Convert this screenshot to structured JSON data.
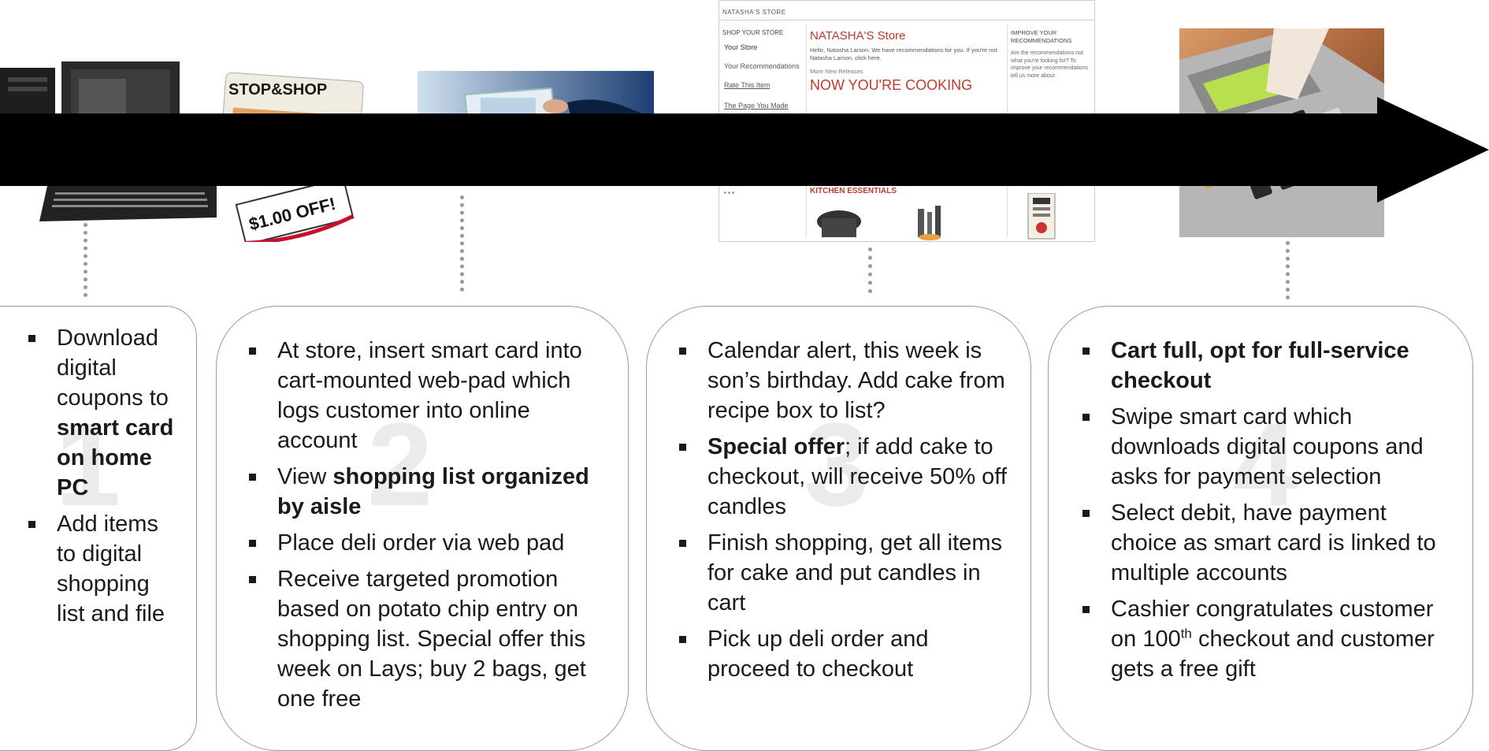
{
  "images": {
    "card_brand": "STOP&SHOP",
    "card_offer": "$1.00 OFF!",
    "store_header": "NATASHA'S STORE",
    "store_nav_title": "SHOP YOUR STORE",
    "store_nav_items": [
      "Your Store",
      "Your Recommendations",
      "Rate This Item",
      "The Page You Made"
    ],
    "store_title": "NATASHA'S Store",
    "store_greeting": "Hello, Natasha Larson. We have recommendations for you. If you're not Natasha Larson, click here.",
    "store_new_releases": "More New Releases",
    "store_banner": "NOW YOU'RE COOKING",
    "store_right_title": "IMPROVE YOUR RECOMMENDATIONS",
    "store_right_text": "Are the recommendations not what you're looking for? To improve your recommendations tell us more about",
    "store_kitchen": "KITCHEN ESSENTIALS"
  },
  "steps": [
    {
      "number": "1",
      "items": [
        {
          "pre": "Download digital coupons to ",
          "bold": "smart card on home PC",
          "post": ""
        },
        {
          "pre": "Add items to digital shopping list and file",
          "bold": "",
          "post": ""
        }
      ]
    },
    {
      "number": "2",
      "items": [
        {
          "pre": "At store, insert smart card into cart-mounted web-pad which logs customer into online account",
          "bold": "",
          "post": ""
        },
        {
          "pre": "View ",
          "bold": "shopping list organized by aisle",
          "post": ""
        },
        {
          "pre": "Place deli order via web pad",
          "bold": "",
          "post": ""
        },
        {
          "pre": "Receive targeted promotion based on potato chip entry on shopping list. Special offer this week on Lays; buy 2 bags, get one free",
          "bold": "",
          "post": ""
        }
      ]
    },
    {
      "number": "3",
      "items": [
        {
          "pre": "Calendar alert, this week is son’s birthday. Add cake from recipe box to list?",
          "bold": "",
          "post": ""
        },
        {
          "pre": "",
          "bold": "Special offer",
          "post": "; if add cake to checkout, will receive 50% off candles"
        },
        {
          "pre": "Finish shopping, get all items for cake and put candles in cart",
          "bold": "",
          "post": ""
        },
        {
          "pre": "Pick up deli order and proceed to checkout",
          "bold": "",
          "post": ""
        }
      ]
    },
    {
      "number": "4",
      "items": [
        {
          "pre": "",
          "bold": "Cart full, opt for full-service checkout",
          "post": ""
        },
        {
          "pre": "Swipe smart card which downloads digital coupons and asks for payment selection",
          "bold": "",
          "post": ""
        },
        {
          "pre": "Select debit, have payment choice as smart card is linked to multiple accounts",
          "bold": "",
          "post": ""
        },
        {
          "pre": "Cashier congratulates customer on 100",
          "bold": "",
          "post": " checkout and customer gets a free gift",
          "sup": "th"
        }
      ]
    }
  ]
}
